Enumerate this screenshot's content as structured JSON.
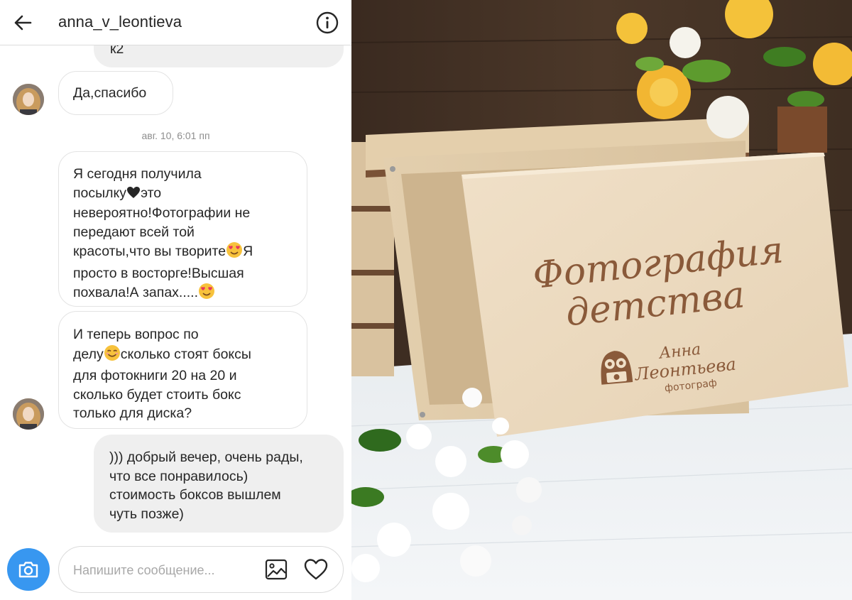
{
  "header": {
    "username": "anna_v_leontieva"
  },
  "messages": [
    {
      "direction": "out",
      "text": "к2"
    },
    {
      "direction": "in",
      "text": "Да,спасибо"
    },
    {
      "direction": "in",
      "lines": [
        "Я сегодня получила",
        "посылку",
        "это",
        "невероятно!Фотографии не",
        "передают всей той",
        "красоты,что вы творите",
        "Я",
        "просто в восторге!Высшая",
        "похвала!А запах....."
      ]
    },
    {
      "direction": "in",
      "lines": [
        "И теперь вопрос по",
        "делу",
        "сколько стоят боксы",
        "для фотокниги 20 на 20 и",
        "сколько будет стоить бокс",
        "только для диска?"
      ]
    },
    {
      "direction": "out",
      "lines": [
        "))) добрый вечер, очень рады,",
        "что все понравилось)",
        "стоимость боксов вышлем",
        "чуть позже)"
      ]
    }
  ],
  "timestamp": "авг. 10, 6:01 пп",
  "composer": {
    "placeholder": "Напишите сообщение..."
  },
  "icons": [
    "back-arrow-icon",
    "info-icon",
    "camera-icon",
    "gallery-icon",
    "heart-icon",
    "heart-emoji-icon",
    "heart-eyes-emoji-icon",
    "smiling-emoji-icon"
  ],
  "photo": {
    "engraving_title_line1": "Фотография",
    "engraving_title_line2": "детства",
    "logo_name_line1": "Анна",
    "logo_name_line2": "Леонтьева",
    "logo_caption": "фотограф"
  },
  "colors": {
    "accent": "#3897f0",
    "incoming_bubble_border": "#e3e3e3",
    "outgoing_bubble": "#efefef",
    "engraving": "#8a5a3a"
  }
}
